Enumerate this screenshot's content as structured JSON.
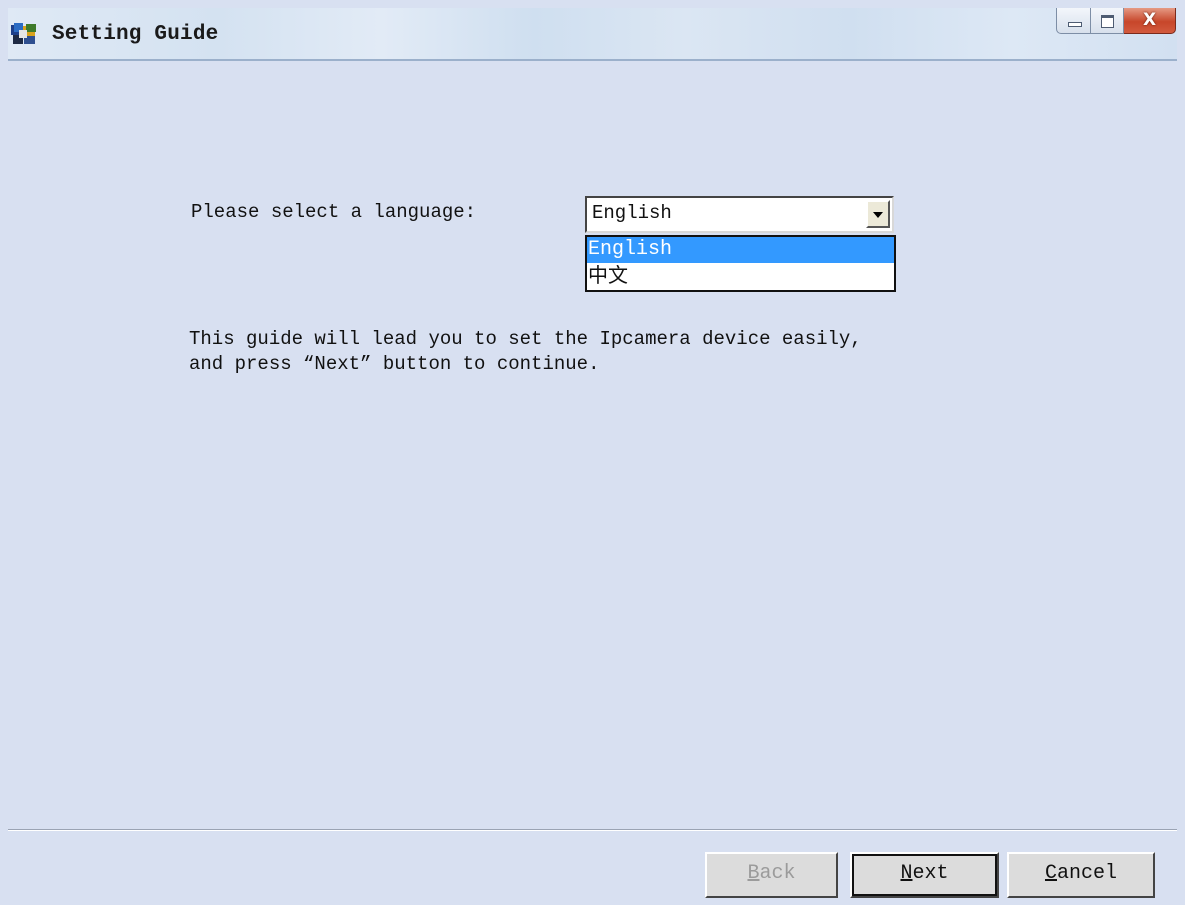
{
  "window": {
    "title": "Setting Guide",
    "icon": "ipcamera-app-icon",
    "controls": {
      "minimize": "minimize-icon",
      "maximize": "maximize-icon",
      "close": "close-icon",
      "close_glyph": "X"
    }
  },
  "language": {
    "label": "Please select a language:",
    "selected": "English",
    "options": [
      "English",
      "中文"
    ],
    "highlighted_index": 0
  },
  "guide": {
    "line1": "This guide will lead you to set the Ipcamera device easily,",
    "line2": "and press “Next” button to continue."
  },
  "buttons": {
    "back": {
      "mnemonic": "B",
      "rest": "ack",
      "enabled": false
    },
    "next": {
      "mnemonic": "N",
      "rest": "ext",
      "enabled": true
    },
    "cancel": {
      "mnemonic": "C",
      "rest": "ancel",
      "enabled": true
    }
  },
  "colors": {
    "body_background": "#d8e0f1",
    "selection": "#3399ff"
  }
}
